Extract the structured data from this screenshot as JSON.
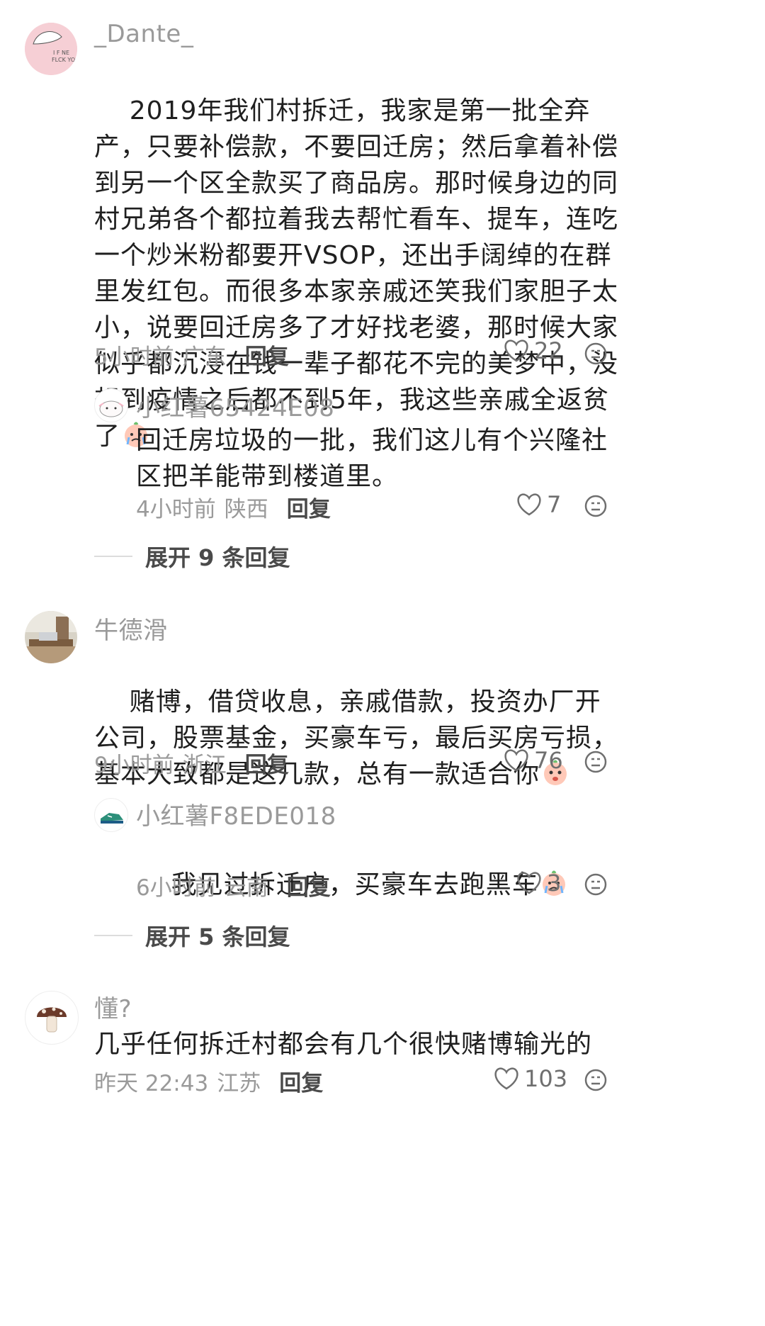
{
  "comments": [
    {
      "username": "_Dante_",
      "avatar_text": "I F NE FLCK YOU",
      "text": "2019年我们村拆迁，我家是第一批全弃产，只要补偿款，不要回迁房；然后拿着补偿到另一个区全款买了商品房。那时候身边的同村兄弟各个都拉着我去帮忙看车、提车，连吃一个炒米粉都要开VSOP，还出手阔绰的在群里发红包。而很多本家亲戚还笑我们家胆子太小，说要回迁房多了才好找老婆，那时候大家似乎都沉浸在钱一辈子都花不完的美梦中，没想到疫情之后都不到5年，我这些亲戚全返贫了",
      "time": "5小时前",
      "location": "广东",
      "reply_label": "回复",
      "likes": "22"
    },
    {
      "username": "小红薯65424E08",
      "text": "回迁房垃圾的一批，我们这儿有个兴隆社区把羊能带到楼道里。",
      "time": "4小时前",
      "location": "陕西",
      "reply_label": "回复",
      "likes": "7"
    },
    {
      "username": "牛德滑",
      "text": "赌博，借贷收息，亲戚借款，投资办厂开公司，股票基金，买豪车亏，最后买房亏损，基本大致都是这几款，总有一款适合你",
      "time": "9小时前",
      "location": "浙江",
      "reply_label": "回复",
      "likes": "76"
    },
    {
      "username": "小红薯F8EDE018",
      "text": "我见过拆迁户，买豪车去跑黑车",
      "time": "6小时前",
      "location": "云南",
      "reply_label": "回复",
      "likes": "3"
    },
    {
      "username": "懂?",
      "text": "几乎任何拆迁村都会有几个很快赌博输光的",
      "time": "昨天 22:43",
      "location": "江苏",
      "reply_label": "回复",
      "likes": "103"
    }
  ],
  "expand_replies": [
    {
      "label": "展开 9 条回复"
    },
    {
      "label": "展开 5 条回复"
    }
  ],
  "icons": {
    "like": "heart-outline-icon",
    "react": "emoji-face-icon",
    "emoji_cry": "crying-face-emoji",
    "emoji_peach": "peach-face-emoji"
  },
  "colors": {
    "muted": "#9a9a9a",
    "text": "#1f1f1f",
    "reply": "#4a4a4a"
  }
}
